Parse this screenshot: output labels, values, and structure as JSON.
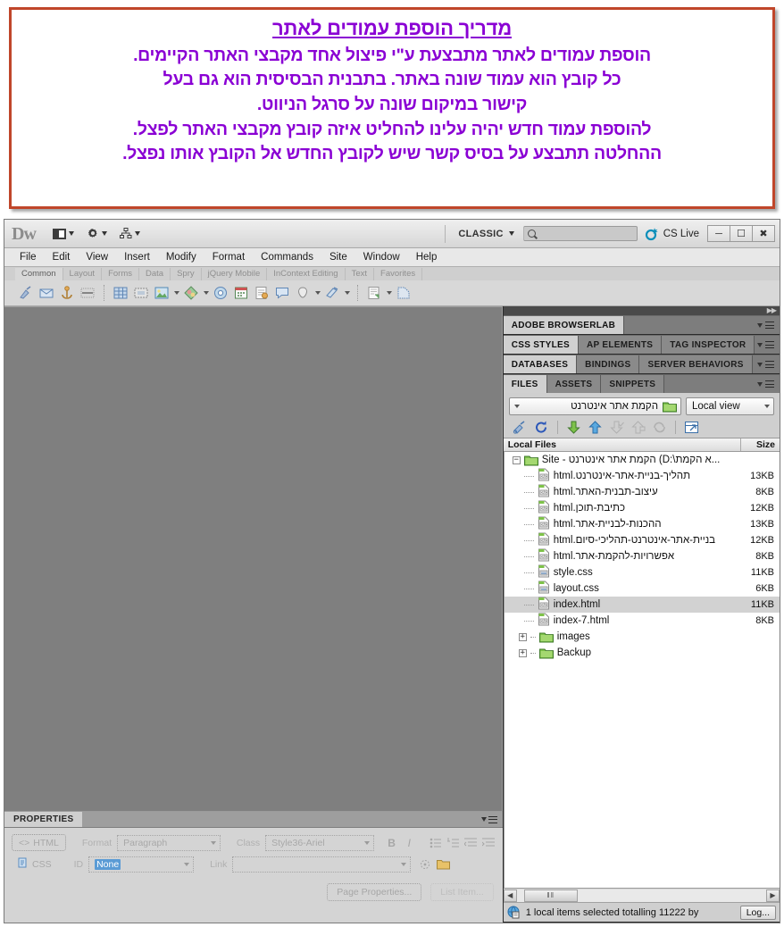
{
  "banner": {
    "title": "מדריך הוספת עמודים לאתר",
    "lines": [
      "הוספת עמודים לאתר מתבצעת ע\"י פיצול אחד מקבצי האתר הקיימים.",
      "כל קובץ הוא עמוד שונה באתר. בתבנית הבסיסית הוא גם בעל",
      "קישור במיקום שונה על סרגל הניווט.",
      "להוספת עמוד חדש יהיה עלינו להחליט איזה קובץ מקבצי האתר לפצל.",
      "ההחלטה תתבצע על בסיס קשר שיש לקובץ החדש אל הקובץ אותו נפצל."
    ],
    "text_color": "#8a00d4",
    "border_color": "#c0462a"
  },
  "app": {
    "logo": "Dw",
    "workspace": "CLASSIC",
    "search_placeholder": "",
    "search_value": "",
    "cs_live": "CS Live",
    "window_buttons": [
      "minimize",
      "restore",
      "close"
    ]
  },
  "menu": {
    "items": [
      "File",
      "Edit",
      "View",
      "Insert",
      "Modify",
      "Format",
      "Commands",
      "Site",
      "Window",
      "Help"
    ]
  },
  "insert_bar": {
    "tabs": [
      "Common",
      "Layout",
      "Forms",
      "Data",
      "Spry",
      "jQuery Mobile",
      "InContext Editing",
      "Text",
      "Favorites"
    ],
    "active_tab": "Common"
  },
  "properties": {
    "panel_title": "PROPERTIES",
    "html_button": "HTML",
    "css_button": "CSS",
    "format_label": "Format",
    "format_value": "Paragraph",
    "id_label": "ID",
    "id_value": "None",
    "class_label": "Class",
    "class_value": "Style36-Ariel",
    "link_label": "Link",
    "link_value": "",
    "page_properties_button": "Page Properties...",
    "list_item_button": "List Item..."
  },
  "dock": {
    "groups": [
      {
        "tabs": [
          "ADOBE BROWSERLAB"
        ],
        "active": "ADOBE BROWSERLAB"
      },
      {
        "tabs": [
          "CSS STYLES",
          "AP ELEMENTS",
          "TAG INSPECTOR"
        ],
        "active": "CSS STYLES"
      },
      {
        "tabs": [
          "DATABASES",
          "BINDINGS",
          "SERVER BEHAVIORS"
        ],
        "active": "DATABASES"
      },
      {
        "tabs": [
          "FILES",
          "ASSETS",
          "SNIPPETS"
        ],
        "active": "FILES"
      }
    ]
  },
  "files_panel": {
    "site_select_value": "הקמת אתר אינטרנט",
    "view_select_value": "Local view",
    "columns": {
      "name": "Local Files",
      "size": "Size"
    },
    "root": {
      "label": "Site - הקמת אתר אינטרנט (D:\\א הקמת...",
      "expanded": true
    },
    "rows": [
      {
        "name": "תהליך-בניית-אתר-אינטרנט.html",
        "size": "13KB",
        "type": "html",
        "rtl": true,
        "selected": false
      },
      {
        "name": "עיצוב-תבנית-האתר.html",
        "size": "8KB",
        "type": "html",
        "rtl": true,
        "selected": false
      },
      {
        "name": "כתיבת-תוכן.html",
        "size": "12KB",
        "type": "html",
        "rtl": true,
        "selected": false
      },
      {
        "name": "ההכנות-לבניית-אתר.html",
        "size": "13KB",
        "type": "html",
        "rtl": true,
        "selected": false
      },
      {
        "name": "בניית-אתר-אינטרנט-תהליכי-סיום.html",
        "size": "12KB",
        "type": "html",
        "rtl": true,
        "selected": false
      },
      {
        "name": "אפשרויות-להקמת-אתר.html",
        "size": "8KB",
        "type": "html",
        "rtl": true,
        "selected": false
      },
      {
        "name": "style.css",
        "size": "11KB",
        "type": "css",
        "rtl": false,
        "selected": false
      },
      {
        "name": "layout.css",
        "size": "6KB",
        "type": "css",
        "rtl": false,
        "selected": false
      },
      {
        "name": "index.html",
        "size": "11KB",
        "type": "html",
        "rtl": false,
        "selected": true
      },
      {
        "name": "index-7.html",
        "size": "8KB",
        "type": "html",
        "rtl": false,
        "selected": false
      },
      {
        "name": "images",
        "size": "",
        "type": "folder",
        "rtl": false,
        "selected": false
      },
      {
        "name": "Backup",
        "size": "",
        "type": "folder",
        "rtl": false,
        "selected": false
      }
    ],
    "status_text": "1 local items selected totalling 11222 by",
    "log_button": "Log..."
  }
}
